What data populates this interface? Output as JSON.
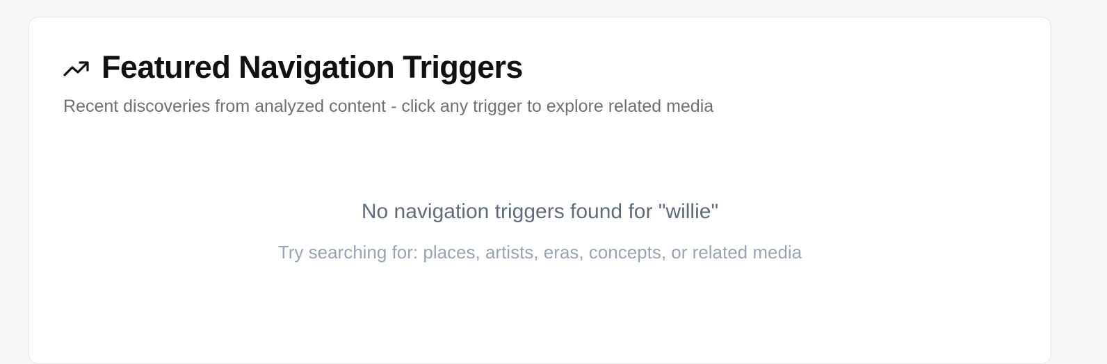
{
  "featured": {
    "icon": "trending-up-icon",
    "title": "Featured Navigation Triggers",
    "subtitle": "Recent discoveries from analyzed content - click any trigger to explore related media"
  },
  "empty_state": {
    "message": "No navigation triggers found for \"willie\"",
    "hint": "Try searching for: places, artists, eras, concepts, or related media"
  },
  "colors": {
    "page_background": "#f6f7f9",
    "card_background": "#ffffff",
    "title": "#111111",
    "subtitle": "#707070",
    "empty_message": "#5f6b7d",
    "empty_hint": "#98a4b6"
  }
}
